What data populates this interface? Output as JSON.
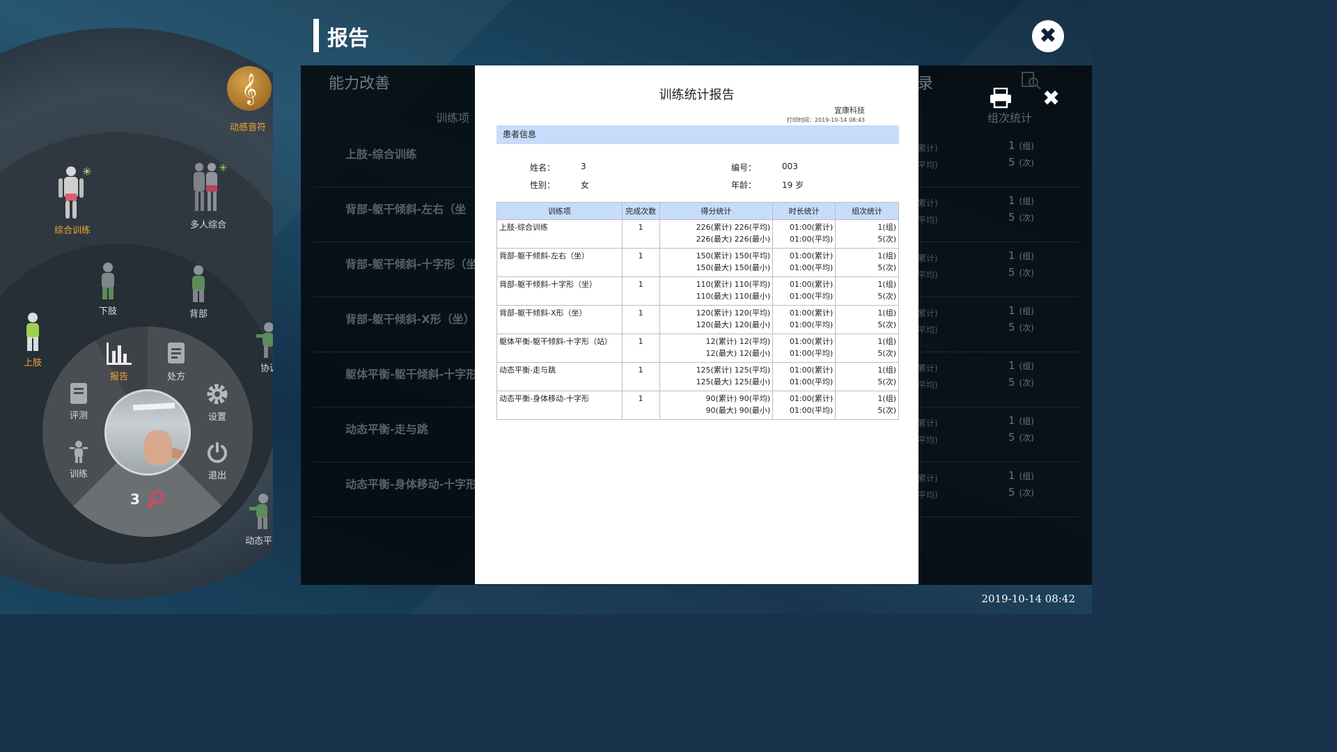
{
  "header": {
    "title": "报告",
    "close": "✖"
  },
  "left_menu": {
    "music": {
      "label": "动感音符",
      "glyph": "𝄞"
    },
    "mode_items": [
      {
        "label": "综合训练",
        "active": true
      },
      {
        "label": "多人综合",
        "active": false
      }
    ],
    "body_parts": [
      {
        "label": "下肢"
      },
      {
        "label": "背部"
      },
      {
        "label": "上肢",
        "active": true
      },
      {
        "label": "协调"
      },
      {
        "label": "动态平"
      }
    ],
    "wheel": {
      "report": "报告",
      "prescription": "处方",
      "assessment": "评测",
      "settings": "设置",
      "training": "训练",
      "exit": "退出"
    },
    "patient_number": "3"
  },
  "background_list": {
    "tab_left": "能力改善",
    "tab_right": "录",
    "col_train": "训练项",
    "col_group": "组次统计",
    "rows": [
      {
        "name": "上肢-综合训练",
        "c1": "累计)",
        "c2": "平均)",
        "g1": "1",
        "g1u": "(组)",
        "g2": "5",
        "g2u": "(次)"
      },
      {
        "name": "背部-躯干倾斜-左右（坐",
        "c1": "累计)",
        "c2": "平均)",
        "g1": "1",
        "g1u": "(组)",
        "g2": "5",
        "g2u": "(次)"
      },
      {
        "name": "背部-躯干倾斜-十字形（坐",
        "c1": "累计)",
        "c2": "平均)",
        "g1": "1",
        "g1u": "(组)",
        "g2": "5",
        "g2u": "(次)"
      },
      {
        "name": "背部-躯干倾斜-X形（坐）",
        "c1": "累计)",
        "c2": "平均)",
        "g1": "1",
        "g1u": "(组)",
        "g2": "5",
        "g2u": "(次)"
      },
      {
        "name": "躯体平衡-躯干倾斜-十字形",
        "c1": "累计)",
        "c2": "平均)",
        "g1": "1",
        "g1u": "(组)",
        "g2": "5",
        "g2u": "(次)"
      },
      {
        "name": "动态平衡-走与跳",
        "c1": "累计)",
        "c2": "平均)",
        "g1": "1",
        "g1u": "(组)",
        "g2": "5",
        "g2u": "(次)"
      },
      {
        "name": "动态平衡-身体移动-十字形",
        "c1": "累计)",
        "c2": "平均)",
        "g1": "1",
        "g1u": "(组)",
        "g2": "5",
        "g2u": "(次)"
      }
    ]
  },
  "document": {
    "title": "训练统计报告",
    "company": "宜康科技",
    "print_time": "打印时间：2019-10-14 08:43",
    "section": "患者信息",
    "patient": {
      "name_label": "姓名：",
      "name": "3",
      "id_label": "编号：",
      "id": "003",
      "gender_label": "性别：",
      "gender": "女",
      "age_label": "年龄：",
      "age": "19 岁"
    },
    "columns": [
      "训练项",
      "完成次数",
      "得分统计",
      "时长统计",
      "组次统计"
    ],
    "rows": [
      {
        "item": "上肢-综合训练",
        "count": "1",
        "score1": "226(累计) 226(平均)",
        "score2": "226(最大) 226(最小)",
        "time1": "01:00(累计)",
        "time2": "01:00(平均)",
        "group1": "1(组)",
        "group2": "5(次)"
      },
      {
        "item": "背部-躯干倾斜-左右（坐）",
        "count": "1",
        "score1": "150(累计) 150(平均)",
        "score2": "150(最大) 150(最小)",
        "time1": "01:00(累计)",
        "time2": "01:00(平均)",
        "group1": "1(组)",
        "group2": "5(次)"
      },
      {
        "item": "背部-躯干倾斜-十字形（坐）",
        "count": "1",
        "score1": "110(累计) 110(平均)",
        "score2": "110(最大) 110(最小)",
        "time1": "01:00(累计)",
        "time2": "01:00(平均)",
        "group1": "1(组)",
        "group2": "5(次)"
      },
      {
        "item": "背部-躯干倾斜-X形（坐）",
        "count": "1",
        "score1": "120(累计) 120(平均)",
        "score2": "120(最大) 120(最小)",
        "time1": "01:00(累计)",
        "time2": "01:00(平均)",
        "group1": "1(组)",
        "group2": "5(次)"
      },
      {
        "item": "躯体平衡-躯干倾斜-十字形（站）",
        "count": "1",
        "score1": "12(累计) 12(平均)",
        "score2": "12(最大) 12(最小)",
        "time1": "01:00(累计)",
        "time2": "01:00(平均)",
        "group1": "1(组)",
        "group2": "5(次)"
      },
      {
        "item": "动态平衡-走与跳",
        "count": "1",
        "score1": "125(累计) 125(平均)",
        "score2": "125(最大) 125(最小)",
        "time1": "01:00(累计)",
        "time2": "01:00(平均)",
        "group1": "1(组)",
        "group2": "5(次)"
      },
      {
        "item": "动态平衡-身体移动-十字形",
        "count": "1",
        "score1": "90(累计) 90(平均)",
        "score2": "90(最大) 90(最小)",
        "time1": "01:00(累计)",
        "time2": "01:00(平均)",
        "group1": "1(组)",
        "group2": "5(次)"
      }
    ]
  },
  "status": {
    "datetime": "2019-10-14 08:42"
  },
  "colors": {
    "accent": "#f2a72b",
    "doc_header": "#c7dcfa",
    "female": "#e0445b"
  }
}
